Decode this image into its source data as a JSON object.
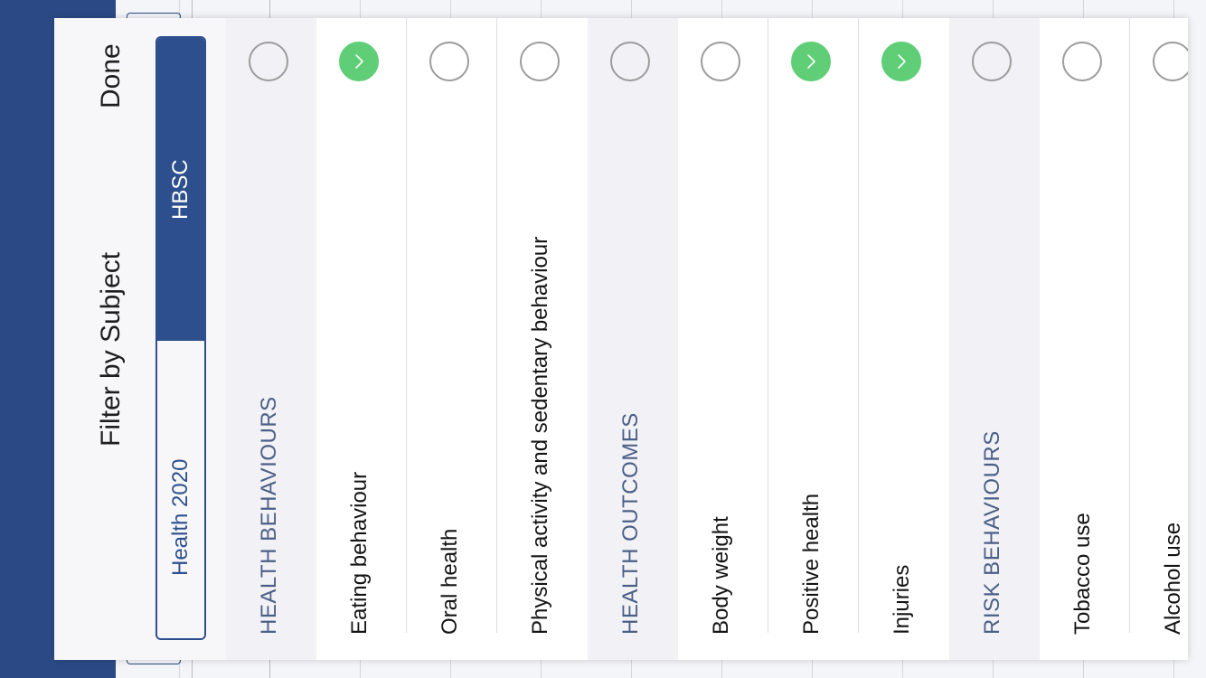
{
  "colors": {
    "sidebar": "#2b4a85",
    "accent": "#2d4f8e",
    "checked": "#5fce76",
    "section_bg": "#f1f1f6"
  },
  "sheet": {
    "title": "Filter by Subject",
    "done_label": "Done"
  },
  "segments": {
    "hbsc": "HBSC",
    "health2020": "Health 2020",
    "selected": "HBSC"
  },
  "rows": [
    {
      "label": "HEALTH BEHAVIOURS",
      "type": "section",
      "checked": false
    },
    {
      "label": "Eating behaviour",
      "type": "item",
      "checked": true
    },
    {
      "label": "Oral health",
      "type": "item",
      "checked": false
    },
    {
      "label": "Physical activity and sedentary behaviour",
      "type": "item",
      "checked": false
    },
    {
      "label": "HEALTH OUTCOMES",
      "type": "section",
      "checked": false
    },
    {
      "label": "Body weight",
      "type": "item",
      "checked": false
    },
    {
      "label": "Positive health",
      "type": "item",
      "checked": true
    },
    {
      "label": "Injuries",
      "type": "item",
      "checked": true
    },
    {
      "label": "RISK BEHAVIOURS",
      "type": "section",
      "checked": false
    },
    {
      "label": "Tobacco use",
      "type": "item",
      "checked": false
    },
    {
      "label": "Alcohol use",
      "type": "item",
      "checked": false
    }
  ]
}
